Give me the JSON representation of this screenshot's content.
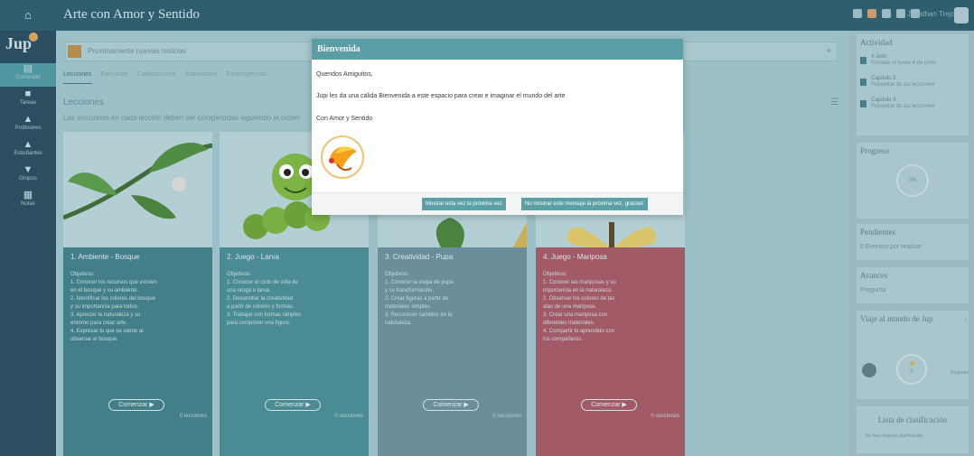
{
  "topbar": {
    "home_icon": "home-icon",
    "title": "Arte con Amor y Sentido",
    "user_name": "Jonathan Trejo"
  },
  "nav": {
    "logo": "Jup",
    "items": [
      {
        "label": "Contenido",
        "icon": "grid-icon"
      },
      {
        "label": "Tareas",
        "icon": "book-icon"
      },
      {
        "label": "Profesores",
        "icon": "person-icon"
      },
      {
        "label": "Estudiantes",
        "icon": "person-icon"
      },
      {
        "label": "Grupos",
        "icon": "trophy-icon"
      },
      {
        "label": "Notas",
        "icon": "doc-icon"
      }
    ]
  },
  "main": {
    "message": "Proximamente nuevas noticias",
    "tabs": [
      "Lecciones",
      "Ejercicios",
      "Calificaciones",
      "Actividades",
      "Recompensas"
    ],
    "section_title": "Lecciones",
    "section_desc": "Las secciones en cada lección deben ser completadas siguiendo el orden",
    "cards": [
      {
        "title": "1. Ambiente - Bosque",
        "lines": [
          "Objetivos:",
          "1. Conocer los recursos que existen",
          "en el bosque y su ambiente.",
          "2. Identificar los colores del bosque",
          "y su importancia para todos.",
          "3. Apreciar la naturaleza y su",
          "entorno para crear arte.",
          "4. Expresar lo que se siente al",
          "observar el bosque."
        ],
        "button": "Comenzar",
        "footer": "0 lecciones"
      },
      {
        "title": "2. Juego - Larva",
        "lines": [
          "Objetivos:",
          "1. Conocer el ciclo de vida de",
          "una oruga o larva.",
          "2. Desarrollar la creatividad",
          "a partir de colores y formas.",
          "3. Trabajar con formas simples",
          "para componer una figura."
        ],
        "button": "Comenzar",
        "footer": "0 secciones"
      },
      {
        "title": "3. Creatividad - Pupa",
        "lines": [
          "Objetivos:",
          "1. Conocer la etapa de pupa",
          "y su transformación.",
          "2. Crear figuras a partir de",
          "materiales simples.",
          "3. Reconocer cambios en la",
          "naturaleza."
        ],
        "button": "Comenzar",
        "footer": "0 secciones"
      },
      {
        "title": "4. Juego - Mariposa",
        "lines": [
          "Objetivos:",
          "1. Conocer las mariposas y su",
          "importancia en la naturaleza.",
          "2. Observar los colores de las",
          "alas de una mariposa.",
          "3. Crear una mariposa con",
          "diferentes materiales.",
          "4. Compartir lo aprendido con",
          "los compañeros."
        ],
        "button": "Comenzar",
        "footer": "0 secciones"
      }
    ]
  },
  "right": {
    "activity_title": "Actividad",
    "activities": [
      {
        "title": "4 Julio",
        "desc": "Enviado el lunes 4 de junio"
      },
      {
        "title": "Capítulo 3",
        "desc": "Presentar de las lecciones"
      },
      {
        "title": "Capítulo 4",
        "desc": "Presentar de las lecciones"
      }
    ],
    "progress_title": "Progreso",
    "progress_value": "0%",
    "events_title": "Pendientes",
    "events_item": "0 Eventos por realizar",
    "notices_title": "Avances",
    "notices_item": "Pregunta",
    "journey_title": "Viaje al mundo de Jup",
    "journey_count": "0",
    "journey_label": "Pregunta",
    "ranking_title": "Lista de clasificación",
    "ranking_desc": "No hay ninguna clasificación"
  },
  "modal": {
    "title": "Bienvenida",
    "greeting": "Queridos Amiguitos,",
    "message": "Jupi les da una cálida Bienvenida a este espacio para crear e imaginar el mundo del arte",
    "signature": "Con Amor y Sentido",
    "button_later": "Mostrar esta vez la próxima vez",
    "button_never": "No mostrar este mensaje la próxima vez, gracias!"
  },
  "colors": {
    "topbar": "#2f5f6e",
    "nav": "#2b4f60",
    "modal_header": "#5b9da4",
    "card_red": "#a35a67"
  }
}
